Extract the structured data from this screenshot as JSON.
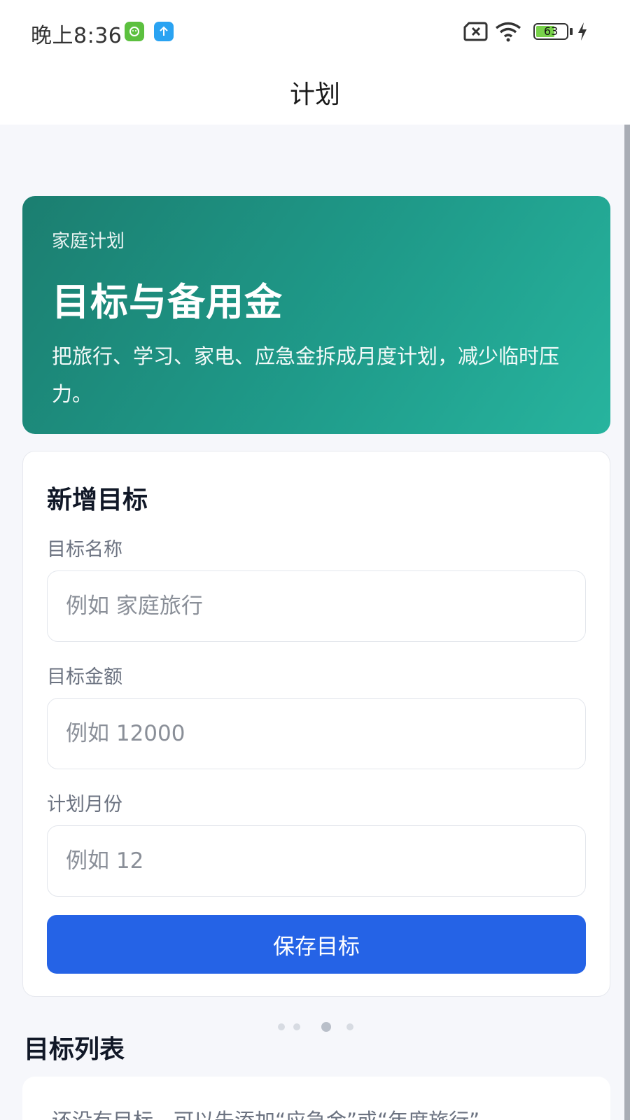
{
  "status_bar": {
    "time": "晚上8:36",
    "battery_level": 63,
    "battery_text": "63",
    "icons": [
      "app-green-icon",
      "upload-arrow-icon",
      "no-sim-icon",
      "wifi-icon",
      "battery-icon",
      "charging-bolt-icon"
    ]
  },
  "nav": {
    "title": "计划"
  },
  "hero": {
    "kicker": "家庭计划",
    "title": "目标与备用金",
    "description": "把旅行、学习、家电、应急金拆成月度计划，减少临时压力。"
  },
  "form": {
    "title": "新增目标",
    "fields": [
      {
        "label": "目标名称",
        "placeholder": "例如 家庭旅行",
        "value": ""
      },
      {
        "label": "目标金额",
        "placeholder": "例如 12000",
        "value": ""
      },
      {
        "label": "计划月份",
        "placeholder": "例如 12",
        "value": ""
      }
    ],
    "save_label": "保存目标"
  },
  "pager": {
    "count": 4,
    "active_index": 2
  },
  "goal_list": {
    "title": "目标列表",
    "empty_text": "还没有目标，可以先添加“应急金”或“年度旅行”"
  },
  "colors": {
    "hero_gradient_start": "#1b7e70",
    "hero_gradient_end": "#27b49e",
    "primary_button": "#2563e6",
    "page_background": "#f6f7fb"
  }
}
